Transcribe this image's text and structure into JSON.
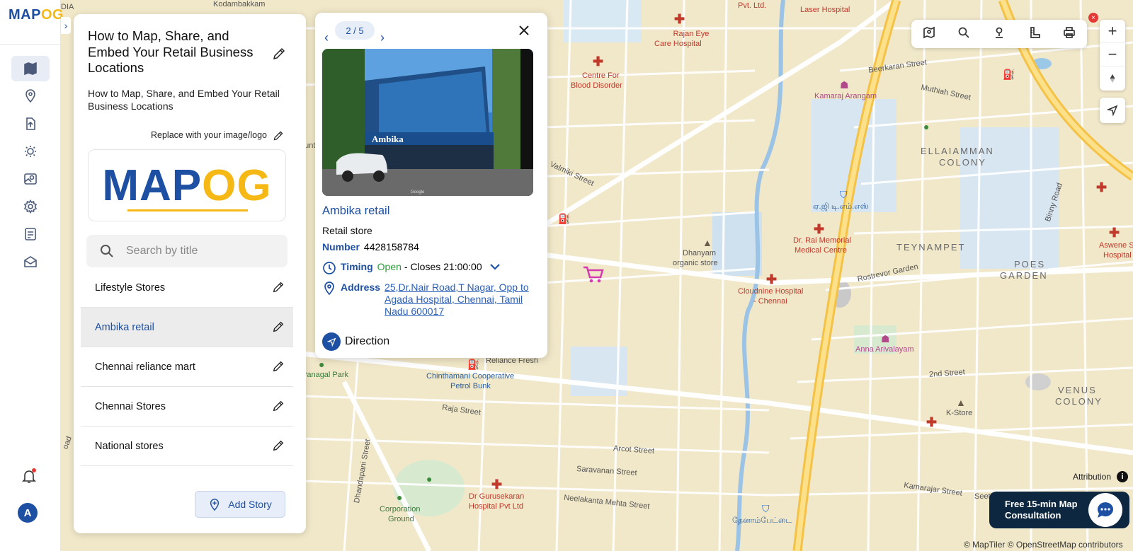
{
  "app": {
    "logo_main": "MAP",
    "logo_accent": "OG"
  },
  "rail": {
    "items": [
      {
        "name": "map-icon"
      },
      {
        "name": "location-pin-icon"
      },
      {
        "name": "upload-icon"
      },
      {
        "name": "settings-sun-icon"
      },
      {
        "name": "map-style-icon"
      },
      {
        "name": "gear-icon"
      },
      {
        "name": "form-list-icon"
      },
      {
        "name": "map-share-icon"
      }
    ],
    "avatar_initial": "A"
  },
  "panel": {
    "title": "How to Map, Share, and Embed Your Retail Business Locations",
    "description": "How to Map, Share, and Embed Your Retail Business Locations",
    "replace_label": "Replace with your image/logo",
    "logo_text_main": "MAP",
    "logo_text_accent": "OG",
    "search_placeholder": "Search by title",
    "stories": [
      {
        "label": "Lifestyle Stores",
        "active": false
      },
      {
        "label": "Ambika retail",
        "active": true
      },
      {
        "label": "Chennai reliance mart",
        "active": false
      },
      {
        "label": "Chennai Stores",
        "active": false
      },
      {
        "label": "National stores",
        "active": false
      }
    ],
    "add_story_label": "Add Story"
  },
  "popup": {
    "pager": "2 / 5",
    "name": "Ambika retail",
    "category": "Retail store",
    "number_label": "Number",
    "number_value": "4428158784",
    "timing_label": "Timing",
    "timing_status": "Open",
    "timing_detail": "- Closes 21:00:00",
    "address_label": "Address",
    "address_value": "25,Dr.Nair Road,T Nagar, Opp to Agada Hospital, Chennai, Tamil Nadu 600017",
    "direction_label": "Direction",
    "photo_sign_text": "Ambika",
    "photo_watermark": "Google"
  },
  "map": {
    "labels": {
      "kodambakkam": "Kodambakkam",
      "dia": "DIA",
      "pvt_ltd": "Pvt. Ltd.",
      "laser_hospital": "Laser Hospital",
      "rajan_eye_1": "Rajan Eye",
      "rajan_eye_2": "Care Hospital",
      "centre_1": "Centre For",
      "centre_2": "Blood Disorder",
      "beerkaran": "Beerkaran Street",
      "kamaraj_arangam": "Kamaraj Arangam",
      "muthiah": "Muthiah Street",
      "ellaiamman_1": "ELLAIAMMAN",
      "ellaiamman_2": "COLONY",
      "valmiki": "Valmiki Street",
      "tamil_ag": "ஏ.ஜி டி.எம்.எஸ்",
      "binny": "Binny Road",
      "dhanyam_1": "Dhanyam",
      "dhanyam_2": "organic store",
      "dr_rai_1": "Dr. Rai Memorial",
      "dr_rai_2": "Medical Centre",
      "teynampet": "TEYNAMPET",
      "poes_1": "POES",
      "poes_2": "GARDEN",
      "aswene_1": "Aswene Sound",
      "aswene_2": "Hospital",
      "rostrevor": "Rostrevor Garden",
      "cloudnine_1": "Cloudnine Hospital",
      "cloudnine_2": "- Chennai",
      "anna_arivalayam": "Anna Arivalayam",
      "reliance_fresh": "Reliance Fresh",
      "panagal_park": "Panagal Park",
      "chinthamani_1": "Chinthamani Cooperative",
      "chinthamani_2": "Petrol Bunk",
      "second_street": "2nd Street",
      "venus_1": "VENUS",
      "venus_2": "COLONY",
      "k_store": "K-Store",
      "raja_street": "Raja Street",
      "arcot": "Arcot Street",
      "saravanan": "Saravanan Street",
      "dhandapani": "Dhandapani Street",
      "dr_guru_1": "Dr Gurusekaran",
      "dr_guru_2": "Hospital Pvt Ltd",
      "neelakanta": "Neelakanta Mehta Street",
      "kamarajar": "Kamarajar Street",
      "seethamma": "Seetha",
      "corporation_1": "Corporation",
      "corporation_2": "Ground",
      "tamil_teynampet": "தேனாம்பேட்டை",
      "sa": "oad",
      "ount": "ount"
    }
  },
  "controls": {
    "attribution_label": "Attribution",
    "attribution_icon": "i",
    "consult_text": "Free 15-min Map Consultation",
    "copyright": "© MapTiler © OpenStreetMap contributors",
    "close_x": "×"
  },
  "colors": {
    "brand_blue": "#1d4fa3",
    "brand_yellow": "#f5b814",
    "map_base": "#f1e7c9",
    "arterial": "#fbd25c",
    "water": "#b8d7ee",
    "park": "#cfe6c3",
    "poi_red": "#c0392b",
    "open_green": "#2e9a3c"
  }
}
